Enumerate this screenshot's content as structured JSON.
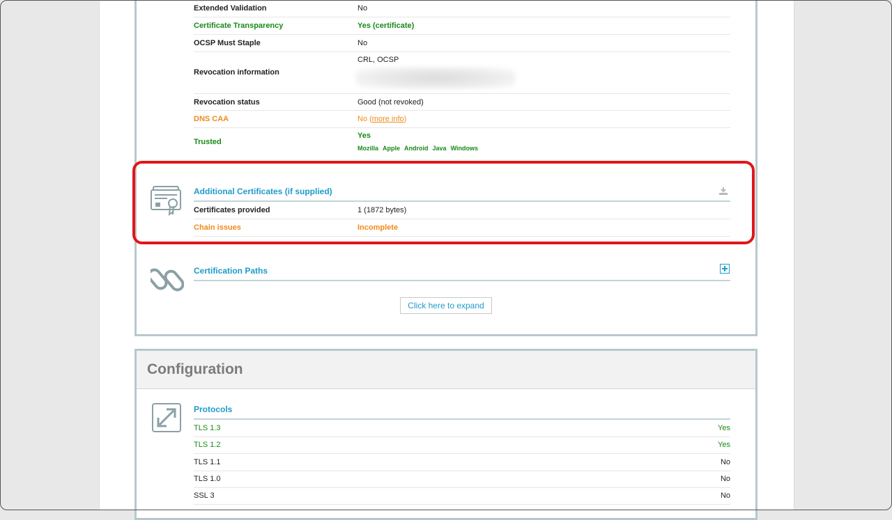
{
  "certificate": {
    "rows": [
      {
        "label": "Extended Validation",
        "value": "No"
      },
      {
        "label": "Certificate Transparency",
        "value": "Yes (certificate)"
      },
      {
        "label": "OCSP Must Staple",
        "value": "No"
      },
      {
        "label": "Revocation information",
        "value": "CRL, OCSP"
      },
      {
        "label": "Revocation status",
        "value": "Good (not revoked)"
      },
      {
        "label": "DNS CAA",
        "value": "No",
        "link": "more info"
      },
      {
        "label": "Trusted",
        "value": "Yes"
      }
    ],
    "trust_stores": [
      "Mozilla",
      "Apple",
      "Android",
      "Java",
      "Windows"
    ]
  },
  "additional_certs": {
    "title": "Additional Certificates (if supplied)",
    "rows": [
      {
        "label": "Certificates provided",
        "value": "1 (1872 bytes)"
      },
      {
        "label": "Chain issues",
        "value": "Incomplete"
      }
    ]
  },
  "cert_paths": {
    "title": "Certification Paths",
    "expand_label": "Click here to expand"
  },
  "configuration": {
    "title": "Configuration",
    "protocols_title": "Protocols",
    "protocols": [
      {
        "name": "TLS 1.3",
        "value": "Yes"
      },
      {
        "name": "TLS 1.2",
        "value": "Yes"
      },
      {
        "name": "TLS 1.1",
        "value": "No"
      },
      {
        "name": "TLS 1.0",
        "value": "No"
      },
      {
        "name": "SSL 3",
        "value": "No"
      }
    ]
  },
  "colors": {
    "accent": "#1e9bcb",
    "good": "#188a18",
    "warning": "#f08a1c",
    "highlight": "#e0161b"
  },
  "icons": [
    "certificate-icon",
    "download-icon",
    "chain-link-icon",
    "expand-plus-icon",
    "protocols-arrows-icon"
  ]
}
